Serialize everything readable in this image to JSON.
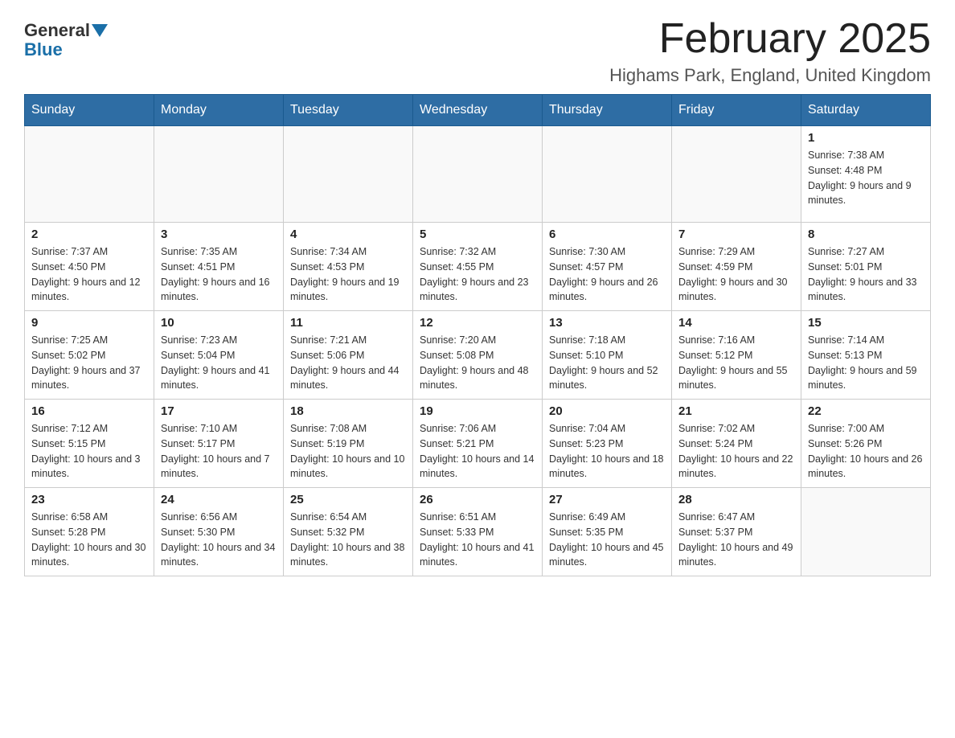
{
  "header": {
    "logo_general": "General",
    "logo_blue": "Blue",
    "month_title": "February 2025",
    "location": "Highams Park, England, United Kingdom"
  },
  "days_of_week": [
    "Sunday",
    "Monday",
    "Tuesday",
    "Wednesday",
    "Thursday",
    "Friday",
    "Saturday"
  ],
  "weeks": [
    [
      {
        "day": "",
        "info": ""
      },
      {
        "day": "",
        "info": ""
      },
      {
        "day": "",
        "info": ""
      },
      {
        "day": "",
        "info": ""
      },
      {
        "day": "",
        "info": ""
      },
      {
        "day": "",
        "info": ""
      },
      {
        "day": "1",
        "info": "Sunrise: 7:38 AM\nSunset: 4:48 PM\nDaylight: 9 hours and 9 minutes."
      }
    ],
    [
      {
        "day": "2",
        "info": "Sunrise: 7:37 AM\nSunset: 4:50 PM\nDaylight: 9 hours and 12 minutes."
      },
      {
        "day": "3",
        "info": "Sunrise: 7:35 AM\nSunset: 4:51 PM\nDaylight: 9 hours and 16 minutes."
      },
      {
        "day": "4",
        "info": "Sunrise: 7:34 AM\nSunset: 4:53 PM\nDaylight: 9 hours and 19 minutes."
      },
      {
        "day": "5",
        "info": "Sunrise: 7:32 AM\nSunset: 4:55 PM\nDaylight: 9 hours and 23 minutes."
      },
      {
        "day": "6",
        "info": "Sunrise: 7:30 AM\nSunset: 4:57 PM\nDaylight: 9 hours and 26 minutes."
      },
      {
        "day": "7",
        "info": "Sunrise: 7:29 AM\nSunset: 4:59 PM\nDaylight: 9 hours and 30 minutes."
      },
      {
        "day": "8",
        "info": "Sunrise: 7:27 AM\nSunset: 5:01 PM\nDaylight: 9 hours and 33 minutes."
      }
    ],
    [
      {
        "day": "9",
        "info": "Sunrise: 7:25 AM\nSunset: 5:02 PM\nDaylight: 9 hours and 37 minutes."
      },
      {
        "day": "10",
        "info": "Sunrise: 7:23 AM\nSunset: 5:04 PM\nDaylight: 9 hours and 41 minutes."
      },
      {
        "day": "11",
        "info": "Sunrise: 7:21 AM\nSunset: 5:06 PM\nDaylight: 9 hours and 44 minutes."
      },
      {
        "day": "12",
        "info": "Sunrise: 7:20 AM\nSunset: 5:08 PM\nDaylight: 9 hours and 48 minutes."
      },
      {
        "day": "13",
        "info": "Sunrise: 7:18 AM\nSunset: 5:10 PM\nDaylight: 9 hours and 52 minutes."
      },
      {
        "day": "14",
        "info": "Sunrise: 7:16 AM\nSunset: 5:12 PM\nDaylight: 9 hours and 55 minutes."
      },
      {
        "day": "15",
        "info": "Sunrise: 7:14 AM\nSunset: 5:13 PM\nDaylight: 9 hours and 59 minutes."
      }
    ],
    [
      {
        "day": "16",
        "info": "Sunrise: 7:12 AM\nSunset: 5:15 PM\nDaylight: 10 hours and 3 minutes."
      },
      {
        "day": "17",
        "info": "Sunrise: 7:10 AM\nSunset: 5:17 PM\nDaylight: 10 hours and 7 minutes."
      },
      {
        "day": "18",
        "info": "Sunrise: 7:08 AM\nSunset: 5:19 PM\nDaylight: 10 hours and 10 minutes."
      },
      {
        "day": "19",
        "info": "Sunrise: 7:06 AM\nSunset: 5:21 PM\nDaylight: 10 hours and 14 minutes."
      },
      {
        "day": "20",
        "info": "Sunrise: 7:04 AM\nSunset: 5:23 PM\nDaylight: 10 hours and 18 minutes."
      },
      {
        "day": "21",
        "info": "Sunrise: 7:02 AM\nSunset: 5:24 PM\nDaylight: 10 hours and 22 minutes."
      },
      {
        "day": "22",
        "info": "Sunrise: 7:00 AM\nSunset: 5:26 PM\nDaylight: 10 hours and 26 minutes."
      }
    ],
    [
      {
        "day": "23",
        "info": "Sunrise: 6:58 AM\nSunset: 5:28 PM\nDaylight: 10 hours and 30 minutes."
      },
      {
        "day": "24",
        "info": "Sunrise: 6:56 AM\nSunset: 5:30 PM\nDaylight: 10 hours and 34 minutes."
      },
      {
        "day": "25",
        "info": "Sunrise: 6:54 AM\nSunset: 5:32 PM\nDaylight: 10 hours and 38 minutes."
      },
      {
        "day": "26",
        "info": "Sunrise: 6:51 AM\nSunset: 5:33 PM\nDaylight: 10 hours and 41 minutes."
      },
      {
        "day": "27",
        "info": "Sunrise: 6:49 AM\nSunset: 5:35 PM\nDaylight: 10 hours and 45 minutes."
      },
      {
        "day": "28",
        "info": "Sunrise: 6:47 AM\nSunset: 5:37 PM\nDaylight: 10 hours and 49 minutes."
      },
      {
        "day": "",
        "info": ""
      }
    ]
  ]
}
